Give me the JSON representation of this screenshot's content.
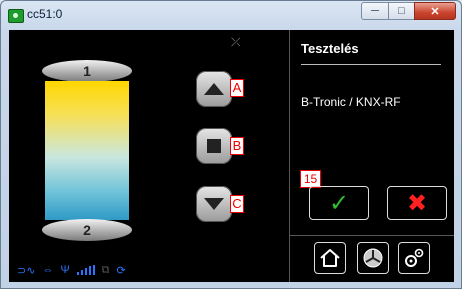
{
  "window": {
    "title": "cc51:0"
  },
  "controls": {
    "min": "─",
    "max": "□",
    "close": "✕"
  },
  "blind": {
    "top_label": "1",
    "bottom_label": "2",
    "buttons": [
      {
        "id": "up",
        "tag": "A"
      },
      {
        "id": "stop",
        "tag": "B"
      },
      {
        "id": "down",
        "tag": "C"
      }
    ]
  },
  "panel": {
    "title": "Tesztelés",
    "subtitle": "B-Tronic / KNX-RF",
    "badge": "15",
    "ok_symbol": "✓",
    "cancel_symbol": "✖"
  },
  "status_icons": [
    "link-icon",
    "connector-icon",
    "antenna-icon",
    "signal-icon",
    "network-icon",
    "refresh-icon"
  ],
  "colors": {
    "ok": "#2fbf2f",
    "cancel": "#ff2020",
    "status": "#2a74ff"
  }
}
